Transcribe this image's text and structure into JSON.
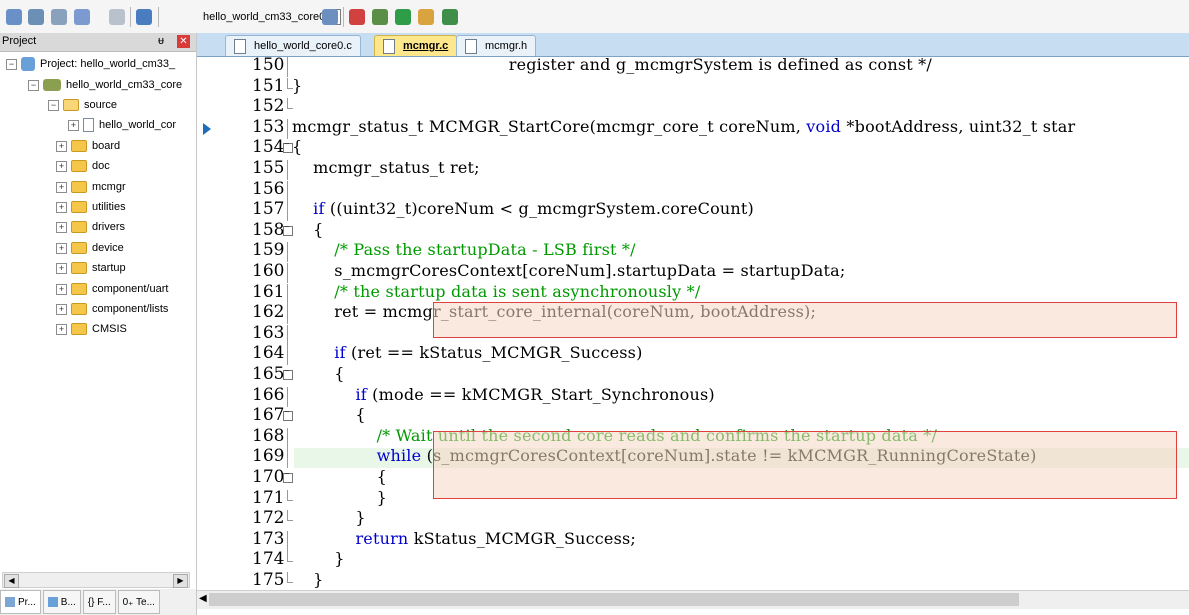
{
  "toolbar": {
    "target": "hello_world_cm33_core0"
  },
  "project": {
    "title": "Project",
    "pin": "ᵾ",
    "close": "✕",
    "root": "Project: hello_world_cm33_",
    "target": "hello_world_cm33_core",
    "source": "source",
    "source_file": "hello_world_cor",
    "groups": [
      "board",
      "doc",
      "mcmgr",
      "utilities",
      "drivers",
      "device",
      "startup",
      "component/uart",
      "component/lists",
      "CMSIS"
    ],
    "tabs": [
      "Pr...",
      "B...",
      "{} F...",
      "0₊ Te..."
    ]
  },
  "editor": {
    "tabs": [
      "hello_world_core0.c",
      "mcmgr.c",
      "mcmgr.h"
    ],
    "active_tab": "mcmgr.c"
  },
  "code": {
    "lines": [
      {
        "n": "150",
        "t": "                                         register and g_mcmgrSystem is defined as const */"
      },
      {
        "n": "151",
        "t": "}"
      },
      {
        "n": "152",
        "t": ""
      },
      {
        "n": "153",
        "t": "mcmgr_status_t MCMGR_StartCore(mcmgr_core_t coreNum, void *bootAddress, uint32_t star"
      },
      {
        "n": "154",
        "t": "{"
      },
      {
        "n": "155",
        "t": "    mcmgr_status_t ret;"
      },
      {
        "n": "156",
        "t": ""
      },
      {
        "n": "157",
        "t": "    if ((uint32_t)coreNum < g_mcmgrSystem.coreCount)"
      },
      {
        "n": "158",
        "t": "    {"
      },
      {
        "n": "159",
        "t": "        /* Pass the startupData - LSB first */"
      },
      {
        "n": "160",
        "t": "        s_mcmgrCoresContext[coreNum].startupData = startupData;"
      },
      {
        "n": "161",
        "t": "        /* the startup data is sent asynchronously */"
      },
      {
        "n": "162",
        "t": "        ret = mcmgr_start_core_internal(coreNum, bootAddress);"
      },
      {
        "n": "163",
        "t": ""
      },
      {
        "n": "164",
        "t": "        if (ret == kStatus_MCMGR_Success)"
      },
      {
        "n": "165",
        "t": "        {"
      },
      {
        "n": "166",
        "t": "            if (mode == kMCMGR_Start_Synchronous)"
      },
      {
        "n": "167",
        "t": "            {"
      },
      {
        "n": "168",
        "t": "                /* Wait until the second core reads and confirms the startup data */"
      },
      {
        "n": "169",
        "t": "                while (s_mcmgrCoresContext[coreNum].state != kMCMGR_RunningCoreState)"
      },
      {
        "n": "170",
        "t": "                {"
      },
      {
        "n": "171",
        "t": "                }"
      },
      {
        "n": "172",
        "t": "            }"
      },
      {
        "n": "173",
        "t": "            return kStatus_MCMGR_Success;"
      },
      {
        "n": "174",
        "t": "        }"
      },
      {
        "n": "175",
        "t": "    }"
      }
    ]
  },
  "colors": {
    "keyword": "#0000cc",
    "comment": "#009900",
    "highlight": "#e04040"
  }
}
